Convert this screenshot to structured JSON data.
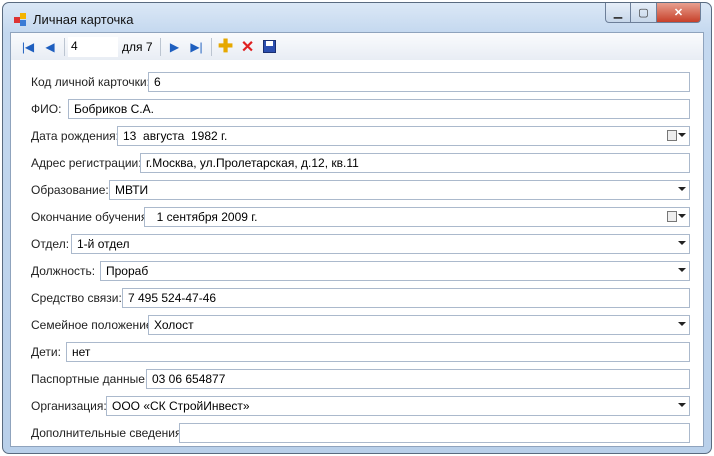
{
  "window": {
    "title": "Личная карточка",
    "minimize": "▁",
    "maximize": "▢",
    "close": "✕"
  },
  "toolbar": {
    "position": "4",
    "count": "для 7"
  },
  "fields": [
    {
      "label": "Код личной карточки:",
      "value": "6",
      "type": "text"
    },
    {
      "label": "ФИО:",
      "value": "Бобриков С.А.",
      "type": "text"
    },
    {
      "label": "Дата рождения:",
      "value": "13  августа  1982 г.",
      "type": "date"
    },
    {
      "label": "Адрес регистрации:",
      "value": "г.Москва, ул.Пролетарская, д.12, кв.11",
      "type": "text"
    },
    {
      "label": "Образование:",
      "value": "МВТИ",
      "type": "combo"
    },
    {
      "label": "Окончание обучения:",
      "value": "  1 сентября 2009 г.",
      "type": "date"
    },
    {
      "label": "Отдел:",
      "value": "1-й отдел",
      "type": "combo"
    },
    {
      "label": "Должность:",
      "value": "Прораб",
      "type": "combo"
    },
    {
      "label": "Средство связи:",
      "value": "7 495 524-47-46",
      "type": "text"
    },
    {
      "label": "Семейное положение:",
      "value": "Холост",
      "type": "combo"
    },
    {
      "label": "Дети:",
      "value": "нет",
      "type": "text"
    },
    {
      "label": "Паспортные данные:",
      "value": "03 06 654877",
      "type": "text"
    },
    {
      "label": "Организация:",
      "value": "ООО «СК СтройИнвест»",
      "type": "combo"
    },
    {
      "label": "Дополнительные сведения:",
      "value": "",
      "type": "text"
    }
  ]
}
